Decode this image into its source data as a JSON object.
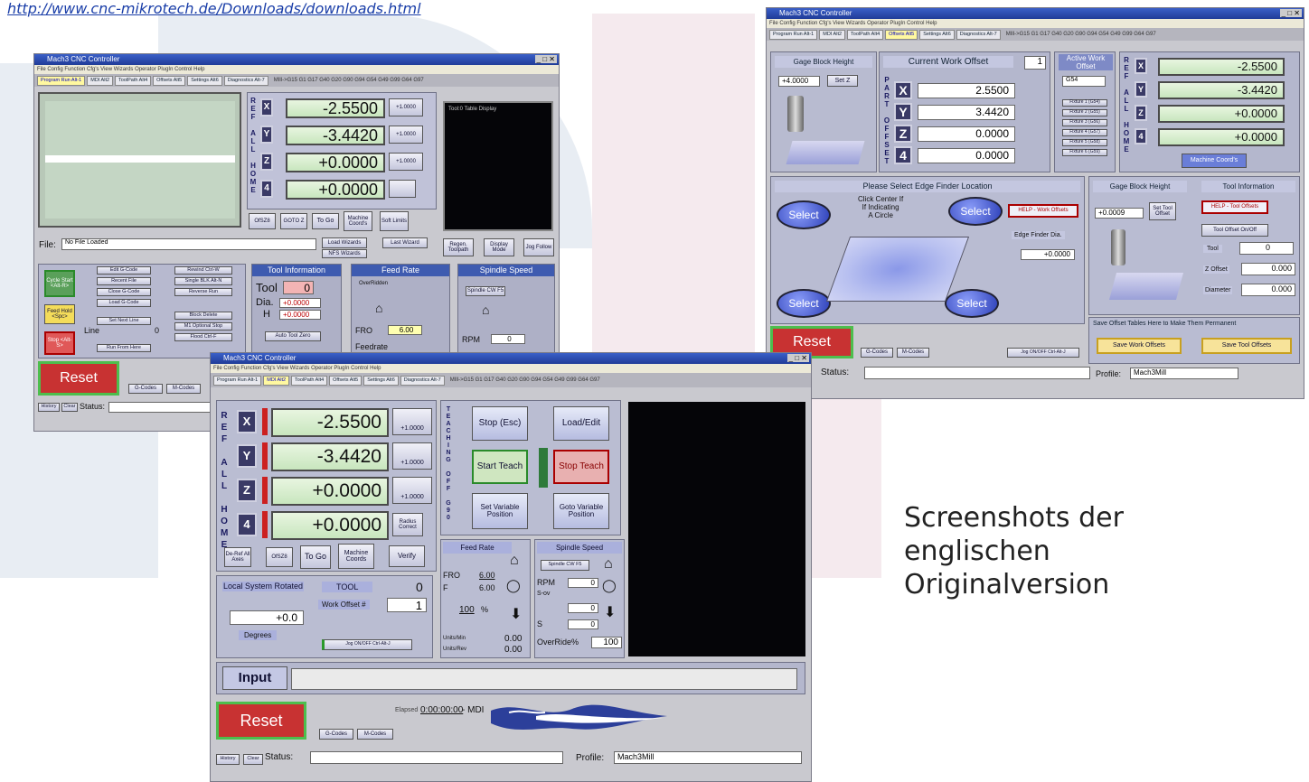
{
  "page": {
    "url_text": "http://www.cnc-mikrotech.de/Downloads/downloads.html",
    "caption": [
      "Screenshots der",
      "englischen",
      "Originalversion"
    ]
  },
  "colors": {
    "stripe_grey": "#e7ecf2",
    "stripe_pink": "#f4e9ec",
    "accent_blue": "#3e5bb0",
    "dro_green": "#c8e6be",
    "reset_red": "#c83232"
  },
  "common": {
    "app_title": "Mach3 CNC Controller",
    "menu": "File  Config  Function Cfg's  View  Wizards  Operator  PlugIn Control  Help",
    "tabs": [
      "Program Run Alt-1",
      "MDI Alt2",
      "ToolPath Alt4",
      "Offsets Alt5",
      "Settings Alt6",
      "Diagnostics Alt-7"
    ],
    "gcodes": "MIll->G15 G1 G17 G40 G20 G90 G94 G54 G49 G99 G64 G97",
    "axes": [
      "X",
      "Y",
      "Z",
      "4"
    ],
    "dro": [
      "-2.5500",
      "-3.4420",
      "+0.0000",
      "+0.0000"
    ],
    "ref_all_home": "REF ALL HOME",
    "reset": "Reset",
    "status_label": "Status:",
    "history": "History",
    "clear": "Clear",
    "gcodes_btn": "G-Codes",
    "mcodes_btn": "M-Codes",
    "profile_label": "Profile:",
    "profile_value": "Mach3Mill",
    "jog_btn": "Jog ON/OFF Ctrl-Alt-J"
  },
  "win_left": {
    "scale": "Scale",
    "scale_val": "+1.0000",
    "tool_display": "Tool:0   Table Display",
    "buttons_row": [
      "OfSZ8",
      "GOTO Z",
      "To Go",
      "Machine Coord's",
      "Soft Limits"
    ],
    "file_label": "File:",
    "file_value": "No File Loaded",
    "load_wizards": "Load Wizards",
    "last_wizard": "Last Wizard",
    "nfs_wizards": "NFS Wizards",
    "side_btns": [
      "Regen. Toolpath",
      "Display Mode",
      "Jog Follow"
    ],
    "run_btns": [
      "Cycle Start <Alt-R>",
      "Feed Hold <Spc>",
      "Stop <Alt-S>"
    ],
    "run_col1": [
      "Edit G-Code",
      "Recent File",
      "Close G-Code",
      "Load G-Code",
      "Set Next Line",
      "Run From Here"
    ],
    "run_col2": [
      "Rewind Ctrl-W",
      "Single BLK Alt-N",
      "Reverse Run",
      "Block Delete",
      "M1 Optional Stop",
      "Flood Ctrl-F"
    ],
    "line_label": "Line",
    "line_value": "0",
    "tool_info_title": "Tool Information",
    "tool_label": "Tool",
    "tool_value": "0",
    "dia_label": "Dia.",
    "dia_value": "+0.0000",
    "h_label": "H",
    "h_value": "+0.0000",
    "auto_tool_zero": "Auto Tool Zero",
    "feed_title": "Feed Rate",
    "overridden": "OverRidden",
    "fro_label": "FRO",
    "fro_value": "6.00",
    "feedrate_label": "Feedrate",
    "spindle_title": "Spindle Speed",
    "spindle_cw": "Spindle CW F5",
    "rpm_label": "RPM",
    "rpm_value": "0"
  },
  "win_right": {
    "gage_title": "Gage Block Height",
    "gage_value": "+4.0000",
    "set_z": "Set Z",
    "cwo_title": "Current Work Offset",
    "cwo_value": "1",
    "part_offset": "PART OFFSET",
    "offsets": [
      "2.5500",
      "3.4420",
      "0.0000",
      "0.0000"
    ],
    "active_wo": "Active Work Offset",
    "active_wo_value": "G54",
    "fixtures": [
      "Fixture 1 (G54)",
      "Fixture 2 (G55)",
      "Fixture 3 (G56)",
      "Fixture 4 (G57)",
      "Fixture 5 (G58)",
      "Fixture 6 (G59)"
    ],
    "machine_coords": "Machine Coord's",
    "edge_title": "Please Select Edge Finder Location",
    "click_center": "Click Center If\nIf Indicating\nA Circle",
    "select": "Select",
    "help_work": "HELP - Work Offsets",
    "edge_dia": "Edge Finder Dia.",
    "edge_dia_value": "+0.0000",
    "gage2_title": "Gage Block Height",
    "gage2_value": "+0.0009",
    "set_tool_offset": "Set Tool Offset",
    "tool_info_title": "Tool Information",
    "help_tool": "HELP - Tool Offsets",
    "tool_offset_onoff": "Tool Offset On/Off",
    "tool_label": "Tool",
    "tool_value": "0",
    "zoffset_label": "Z Offset",
    "zoffset_value": "0.000",
    "diameter_label": "Diameter",
    "diameter_value": "0.000",
    "save_text": "Save Offset Tables Here to Make Them Permanent",
    "save_work": "Save Work Offsets",
    "save_tool": "Save Tool Offsets"
  },
  "win_front": {
    "zero_label": "Zero",
    "scale_val": "+1.0000",
    "radius_correct": "Radius Correct",
    "bottom_btns": [
      "De-Ref All Axes",
      "OfSZ8",
      "To Go",
      "Machine Coords",
      "Verify"
    ],
    "teach_label": "TEACHING OFF G90",
    "stop_esc": "Stop (Esc)",
    "load_edit": "Load/Edit",
    "start_teach": "Start Teach",
    "stop_teach": "Stop Teach",
    "set_variable": "Set Variable Position",
    "goto_variable": "Goto Variable Position",
    "local_system": "Local System Rotated",
    "rot_value": "+0.0",
    "degrees": "Degrees",
    "tool_label": "TOOL",
    "tool_value": "0",
    "work_offset": "Work Offset #",
    "work_offset_value": "1",
    "feed_title": "Feed Rate",
    "fro_label": "FRO",
    "fro_value": "6.00",
    "f_label": "F",
    "f_value": "6.00",
    "fro_pct": "100",
    "pct": "%",
    "units_min": "Units/Min",
    "units_min_value": "0.00",
    "units_rev": "Units/Rev",
    "units_rev_value": "0.00",
    "spindle_title": "Spindle Speed",
    "spindle_cw": "Spindle CW F5",
    "rpm_label": "RPM",
    "rpm_value": "0",
    "sov_label": "S-ov",
    "sov_value": "0",
    "s_label": "S",
    "s_value": "0",
    "override_label": "OverRide%",
    "override_value": "100",
    "input_label": "Input",
    "elapsed_label": "Elapsed",
    "elapsed_value": "0:00:00:00",
    "mdi_label": "- MDI"
  }
}
